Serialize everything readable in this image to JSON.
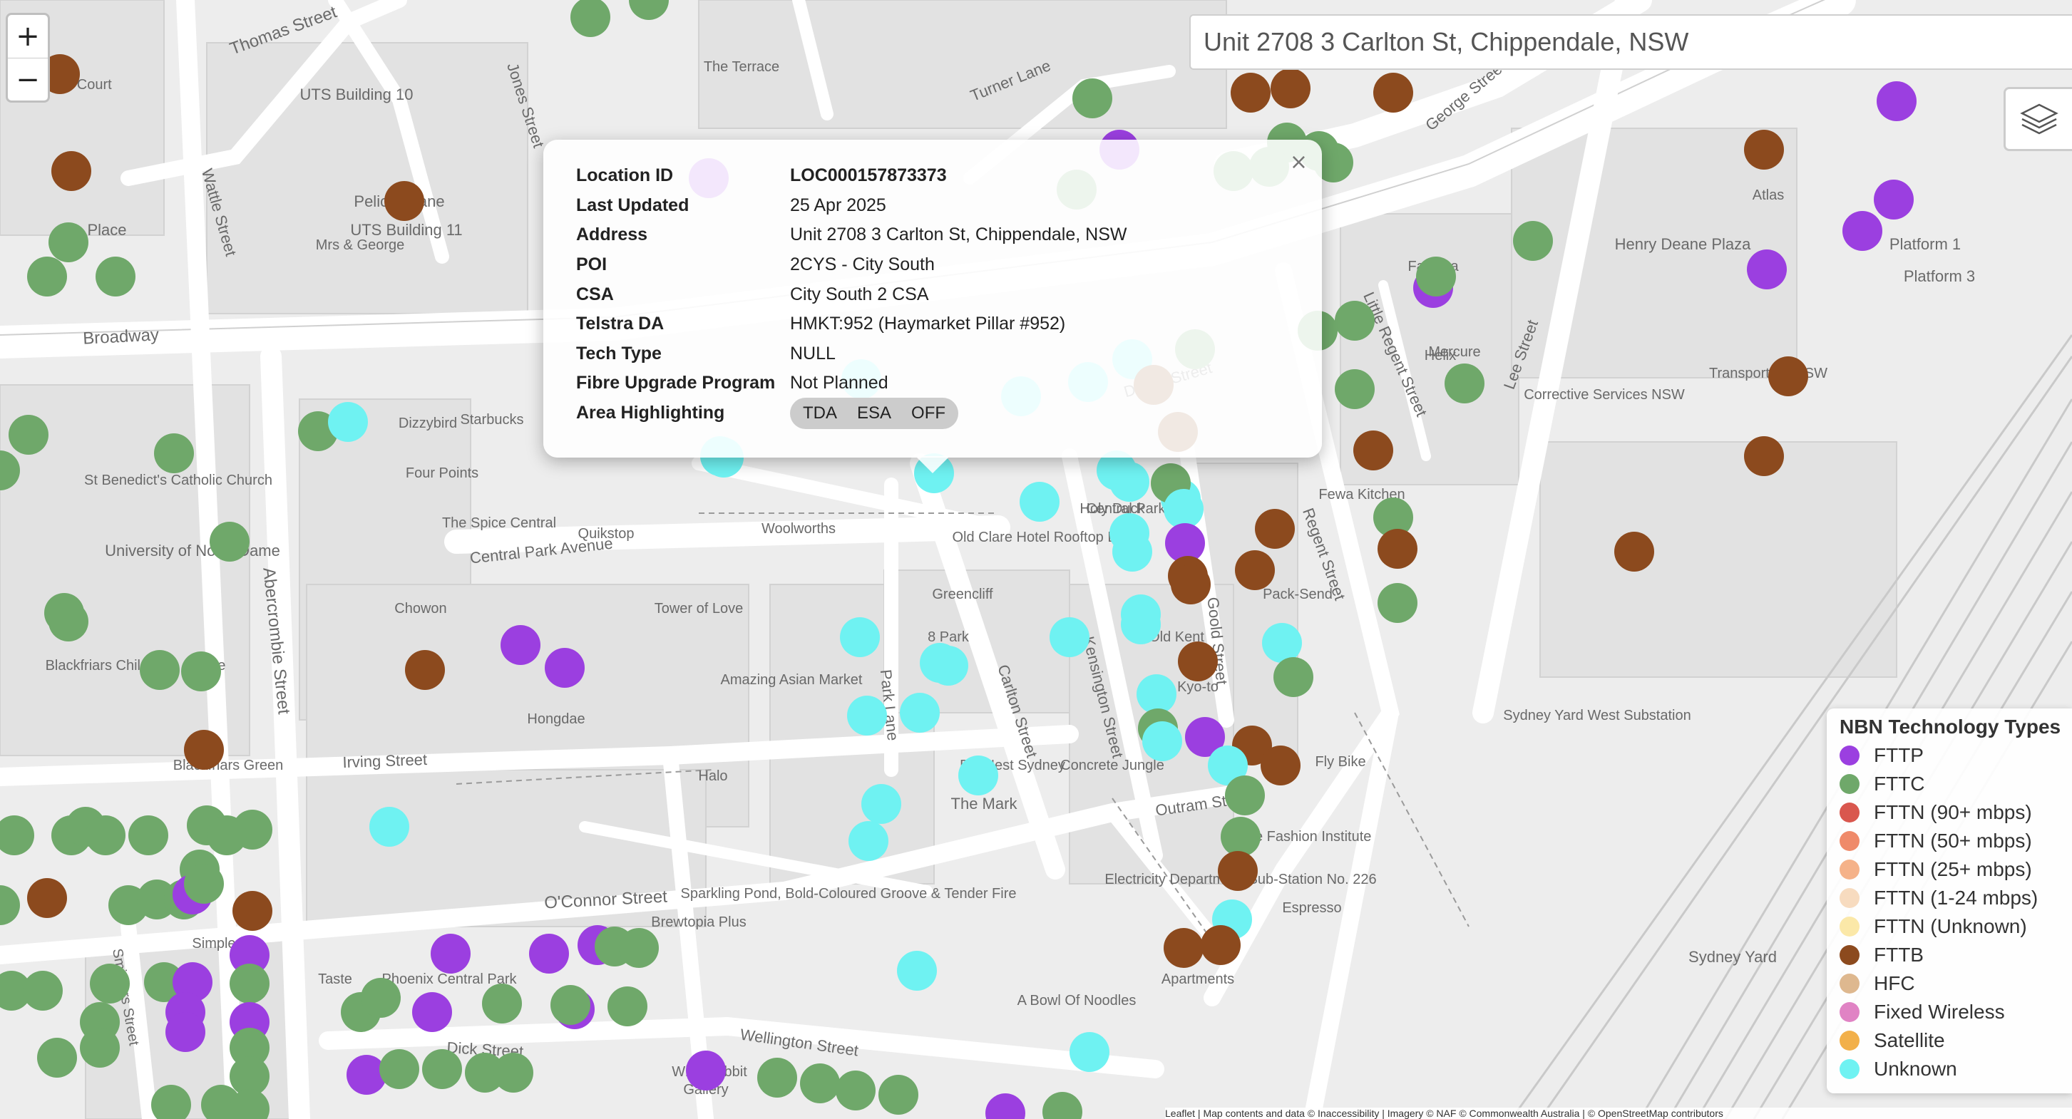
{
  "search": {
    "value": "Unit 2708 3 Carlton St, Chippendale, NSW"
  },
  "zoom": {
    "in_label": "+",
    "out_label": "−"
  },
  "layers": {
    "icon": "layers-icon"
  },
  "popup": {
    "close_label": "×",
    "rows": [
      {
        "label": "Location ID",
        "value": "LOC000157873373"
      },
      {
        "label": "Last Updated",
        "value": "25 Apr 2025"
      },
      {
        "label": "Address",
        "value": "Unit 2708 3 Carlton St, Chippendale, NSW"
      },
      {
        "label": "POI",
        "value": "2CYS - City South"
      },
      {
        "label": "CSA",
        "value": "City South 2 CSA"
      },
      {
        "label": "Telstra DA",
        "value": "HMKT:952 (Haymarket Pillar #952)"
      },
      {
        "label": "Tech Type",
        "value": "NULL"
      },
      {
        "label": "Fibre Upgrade Program",
        "value": "Not Planned"
      }
    ],
    "area_highlighting": {
      "label": "Area Highlighting",
      "options": [
        "TDA",
        "ESA",
        "OFF"
      ]
    }
  },
  "legend": {
    "title": "NBN Technology Types",
    "items": [
      {
        "label": "FTTP",
        "color": "#9b3fe0"
      },
      {
        "label": "FTTC",
        "color": "#6fa86a"
      },
      {
        "label": "FTTN (90+ mbps)",
        "color": "#d9574e"
      },
      {
        "label": "FTTN (50+ mbps)",
        "color": "#ef8a6a"
      },
      {
        "label": "FTTN (25+ mbps)",
        "color": "#f5b289"
      },
      {
        "label": "FTTN (1-24 mbps)",
        "color": "#f7dbbf"
      },
      {
        "label": "FTTN (Unknown)",
        "color": "#fbe8a8"
      },
      {
        "label": "FTTB",
        "color": "#8c4a1e"
      },
      {
        "label": "HFC",
        "color": "#deb88f"
      },
      {
        "label": "Fixed Wireless",
        "color": "#e083c4"
      },
      {
        "label": "Satellite",
        "color": "#f2b04a"
      },
      {
        "label": "Unknown",
        "color": "#6ff2f2"
      }
    ]
  },
  "map_labels": [
    "Thomas Street",
    "Jones Street",
    "Wattle Street",
    "Broadway",
    "Abercrombie Street",
    "Central Park Avenue",
    "Irving Street",
    "O'Connor Street",
    "Dick Street",
    "Wellington Street",
    "Park Lane",
    "Carlton Street",
    "Kensington Street",
    "Goold Street",
    "Outram Street",
    "Regent Street",
    "Little Regent Street",
    "Lee Street",
    "George Street",
    "Turner Lane",
    "Dwyer Street",
    "Smithers Street",
    "Pelican Lane",
    "Place",
    "UTS Building 10",
    "UTS Building 11",
    "The Terrace",
    "Henry Deane Plaza",
    "Platform 1",
    "Platform 3",
    "Sydney Yard West Substation",
    "Sydney Yard",
    "Corrective Services NSW",
    "Electricity Department Sub-Station No. 226",
    "The Fashion Institute",
    "Greencliff",
    "8 Park",
    "Tower of Love",
    "Chowon",
    "Hongdae",
    "Halo",
    "The Mark",
    "Big Nest Sydney",
    "Concrete Jungle",
    "Fly Bike",
    "Pack-Send",
    "Fewa Kitchen",
    "Mercure",
    "Central Park Mall",
    "Old Clare Hotel Rooftop Bar",
    "Quikstop",
    "Woolworths",
    "The Spice Central",
    "Four Points",
    "Dizzybird",
    "Starbucks",
    "St Benedict's Catholic Church",
    "University of Notre Dame",
    "Blackfriars Children's Centre",
    "Blackfriars Green",
    "Amazing Asian Market",
    "Sparkling Pond, Bold-Coloured Groove & Tender Fire",
    "Brewtopia Plus",
    "A Bowl Of Noodles",
    "Phoenix Central Park",
    "Simple",
    "Taste",
    "Kyo-to",
    "Old Kent",
    "Holy Duck",
    "Apartments",
    "Espresso",
    "Mrs & George",
    "Fastima",
    "Helix",
    "Atlas",
    "Transport for NSW",
    "Gallery",
    "Whitebobbit",
    "Rmant Court"
  ],
  "attribution": "Leaflet | Map contents and data © Inaccessibility | Imagery © NAF © Commonwealth Australia | © OpenStreetMap contributors"
}
